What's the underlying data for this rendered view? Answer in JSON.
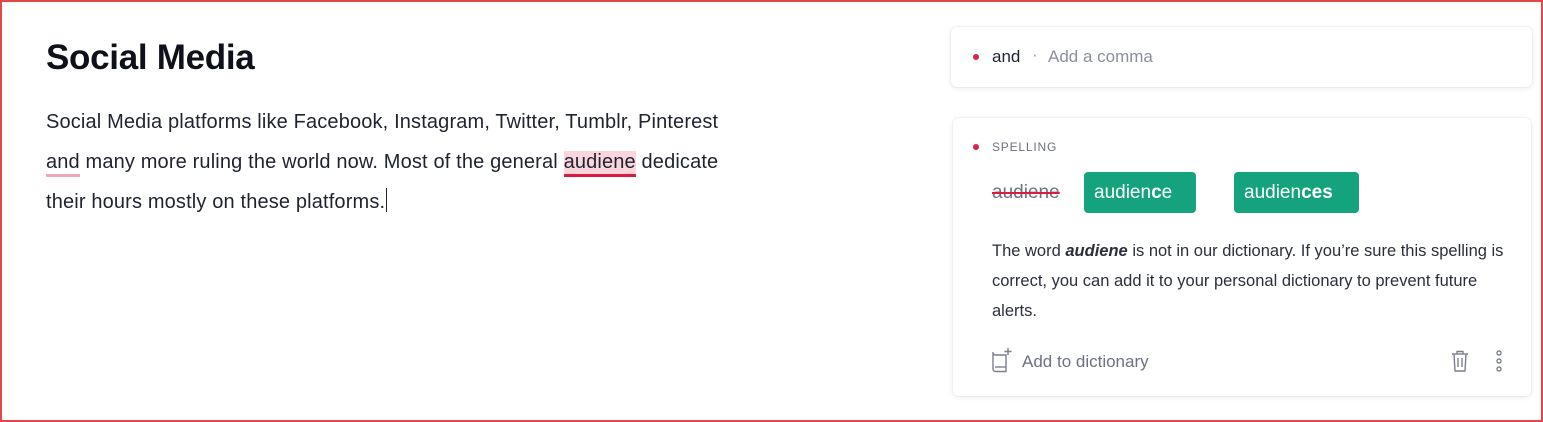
{
  "document": {
    "title": "Social Media",
    "body": {
      "seg1": "Social Media platforms like Facebook, Instagram, Twitter, Tumblr, Pinterest ",
      "comma_word": "and",
      "seg2": " many more ruling the world now. Most of the general ",
      "spell_word": "audiene",
      "seg3": " dedicate their hours mostly on these platforms."
    }
  },
  "suggestions_panel": {
    "collapsed_card": {
      "word": "and",
      "separator": "·",
      "hint": "Add a comma"
    },
    "expanded_card": {
      "category": "SPELLING",
      "original_word": "audiene",
      "arrow": "→",
      "suggestions": [
        {
          "base": "audien",
          "changed": "c",
          "rest": "e"
        },
        {
          "base": "audien",
          "changed": "ces",
          "rest": ""
        }
      ],
      "explanation": {
        "pre": "The word ",
        "keyword": "audiene",
        "post": " is not in our dictionary. If you’re sure this spelling is correct, you can add it to your personal dictionary to prevent future alerts."
      },
      "add_to_dictionary_label": "Add to dictionary",
      "icons": {
        "add_dictionary": "book-plus-icon",
        "delete": "trash-icon",
        "more": "more-vertical-icon"
      }
    }
  },
  "colors": {
    "frame_border": "#e3474a",
    "alert_dot": "#d9244f",
    "spell_underline": "#d81b3f",
    "spell_highlight": "#fbd5dc",
    "comma_underline": "#f3a7b6",
    "suggestion_bg": "#15a37e"
  }
}
